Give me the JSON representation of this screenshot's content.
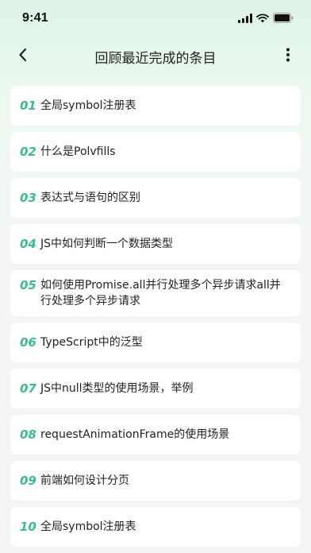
{
  "status_bar": {
    "time": "9:41"
  },
  "header": {
    "title": "回顾最近完成的条目",
    "back_icon": "chevron-left-icon",
    "more_icon": "more-vertical-icon"
  },
  "colors": {
    "accent": "#3dbb86",
    "background_top": "#dff4e6",
    "card": "#ffffff",
    "text": "#222222"
  },
  "items": [
    {
      "index": "01",
      "title": "全局symbol注册表"
    },
    {
      "index": "02",
      "title": "什么是Polvfills"
    },
    {
      "index": "03",
      "title": "表达式与语句的区别"
    },
    {
      "index": "04",
      "title": "JS中如何判断一个数据类型"
    },
    {
      "index": "05",
      "title": "如何使用Promise.all并行处理多个异步请求all并行处理多个异步请求"
    },
    {
      "index": "06",
      "title": "TypeScript中的泛型"
    },
    {
      "index": "07",
      "title": "JS中null类型的使用场景，举例"
    },
    {
      "index": "08",
      "title": "requestAnimationFrame的使用场景"
    },
    {
      "index": "09",
      "title": "前端如何设计分页"
    },
    {
      "index": "10",
      "title": "全局symbol注册表"
    }
  ]
}
